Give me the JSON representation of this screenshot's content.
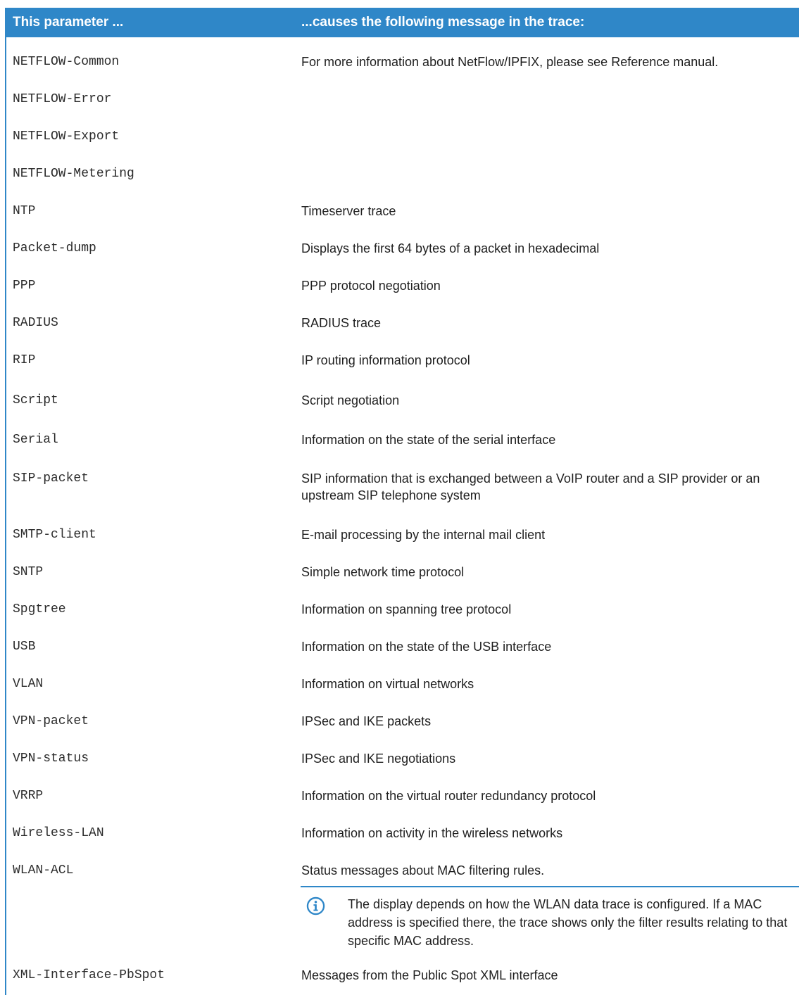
{
  "table": {
    "headers": [
      "This parameter ...",
      "...causes the following message in the trace:"
    ],
    "rows": [
      {
        "param": "NETFLOW-Common",
        "message": "For more information about NetFlow/IPFIX, please see Reference manual."
      },
      {
        "param": "NETFLOW-Error",
        "message": ""
      },
      {
        "param": "NETFLOW-Export",
        "message": ""
      },
      {
        "param": "NETFLOW-Metering",
        "message": ""
      },
      {
        "param": "NTP",
        "message": "Timeserver trace"
      },
      {
        "param": "Packet-dump",
        "message": "Displays the first 64 bytes of a packet in hexadecimal"
      },
      {
        "param": "PPP",
        "message": "PPP protocol negotiation"
      },
      {
        "param": "RADIUS",
        "message": "RADIUS trace"
      },
      {
        "param": "RIP",
        "message": "IP routing information protocol"
      },
      {
        "param": "Script",
        "message": "Script negotiation"
      },
      {
        "param": "Serial",
        "message": "Information on the state of the serial interface"
      },
      {
        "param": "SIP-packet",
        "message": "SIP information that is exchanged between a VoIP router and a SIP provider or an upstream SIP telephone system"
      },
      {
        "param": "SMTP-client",
        "message": "E-mail processing by the internal mail client"
      },
      {
        "param": "SNTP",
        "message": "Simple network time protocol"
      },
      {
        "param": "Spgtree",
        "message": "Information on spanning tree protocol"
      },
      {
        "param": "USB",
        "message": "Information on the state of the USB interface"
      },
      {
        "param": "VLAN",
        "message": "Information on virtual networks"
      },
      {
        "param": "VPN-packet",
        "message": "IPSec and IKE packets"
      },
      {
        "param": "VPN-status",
        "message": "IPSec and IKE negotiations"
      },
      {
        "param": "VRRP",
        "message": "Information on the virtual router redundancy protocol"
      },
      {
        "param": "Wireless-LAN",
        "message": "Information on activity in the wireless networks"
      },
      {
        "param": "WLAN-ACL",
        "message": "Status messages about MAC filtering rules."
      },
      {
        "param": "XML-Interface-PbSpot",
        "message": "Messages from the Public Spot XML interface"
      }
    ],
    "note": {
      "icon": "info-icon",
      "text": "The display depends on how the WLAN data trace is configured. If a MAC address is specified there, the trace shows only the filter results relating to that specific MAC address."
    }
  },
  "colors": {
    "accent": "#2f87c8",
    "header_text": "#ffffff"
  }
}
